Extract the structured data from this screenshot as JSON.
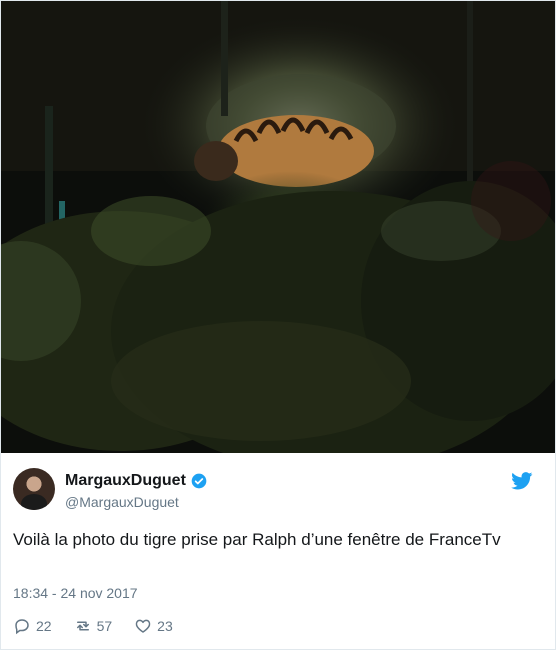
{
  "tweet": {
    "display_name": "MargauxDuguet",
    "handle": "@MargauxDuguet",
    "text": "Voilà la photo du tigre prise par Ralph d’une fenêtre de FranceTv",
    "timestamp": "18:34 - 24 nov 2017",
    "verified": true,
    "icons": {
      "verified": "verified-badge-icon",
      "brand": "twitter-bird-icon",
      "reply": "reply-icon",
      "retweet": "retweet-icon",
      "like": "heart-icon"
    },
    "actions": {
      "replies": "22",
      "retweets": "57",
      "likes": "23"
    },
    "colors": {
      "brand": "#1da1f2",
      "text": "#14171a",
      "secondary": "#657786"
    }
  }
}
